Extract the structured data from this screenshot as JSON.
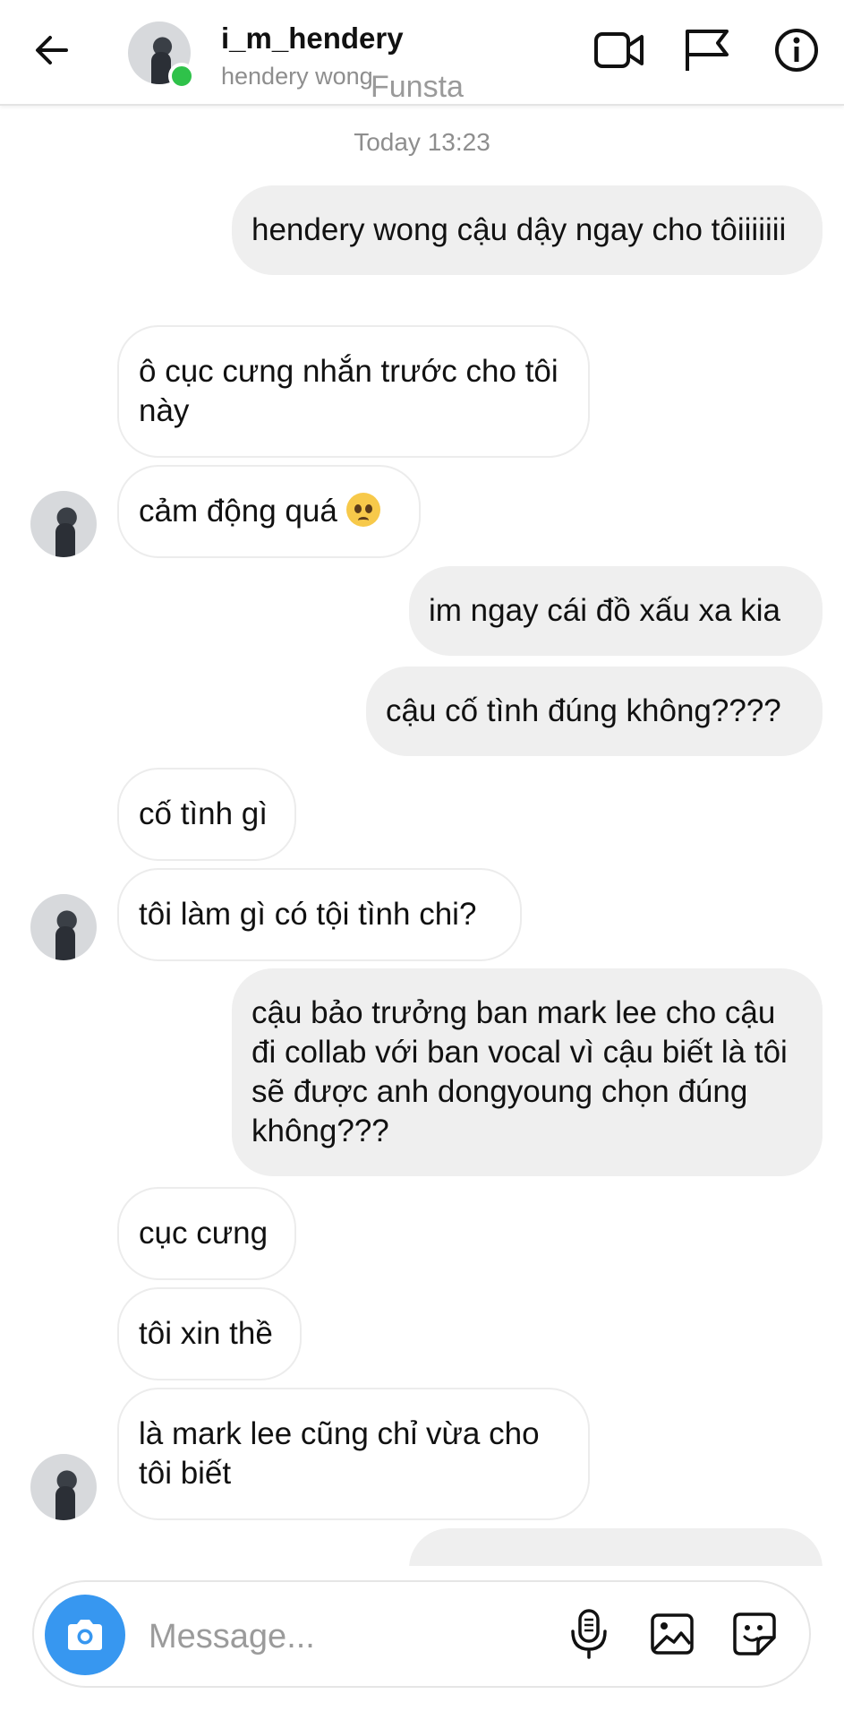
{
  "header": {
    "username": "i_m_hendery",
    "subtitle": "hendery wong",
    "watermark": "Funsta"
  },
  "chat": {
    "timestamp": "Today 13:23",
    "messages": [
      {
        "side": "sent",
        "text": "hendery wong cậu dậy ngay cho tôiiiiiii"
      },
      {
        "side": "received",
        "text": "ô cục cưng nhắn trước cho tôi này"
      },
      {
        "side": "received",
        "text": "cảm động quá",
        "emoji": "pleading-face"
      },
      {
        "side": "sent",
        "text": "im ngay cái đồ xấu xa kia"
      },
      {
        "side": "sent",
        "text": "cậu cố tình đúng không????"
      },
      {
        "side": "received",
        "text": "cố tình gì"
      },
      {
        "side": "received",
        "text": "tôi làm gì có tội tình chi?"
      },
      {
        "side": "sent",
        "text": "cậu bảo trưởng ban mark lee cho cậu đi collab với ban vocal vì cậu biết là tôi sẽ được anh dongyoung chọn đúng không???"
      },
      {
        "side": "received",
        "text": "cục cưng"
      },
      {
        "side": "received",
        "text": "tôi xin thề"
      },
      {
        "side": "received",
        "text": "là mark lee cũng chỉ vừa cho tôi biết"
      }
    ]
  },
  "composer": {
    "placeholder": "Message...",
    "icons": [
      "camera-icon",
      "microphone-icon",
      "gallery-icon",
      "sticker-icon"
    ],
    "accent": "#3797f0"
  },
  "colors": {
    "sent_bubble": "#efefef",
    "received_border": "#ececec",
    "online": "#2fc24a"
  }
}
